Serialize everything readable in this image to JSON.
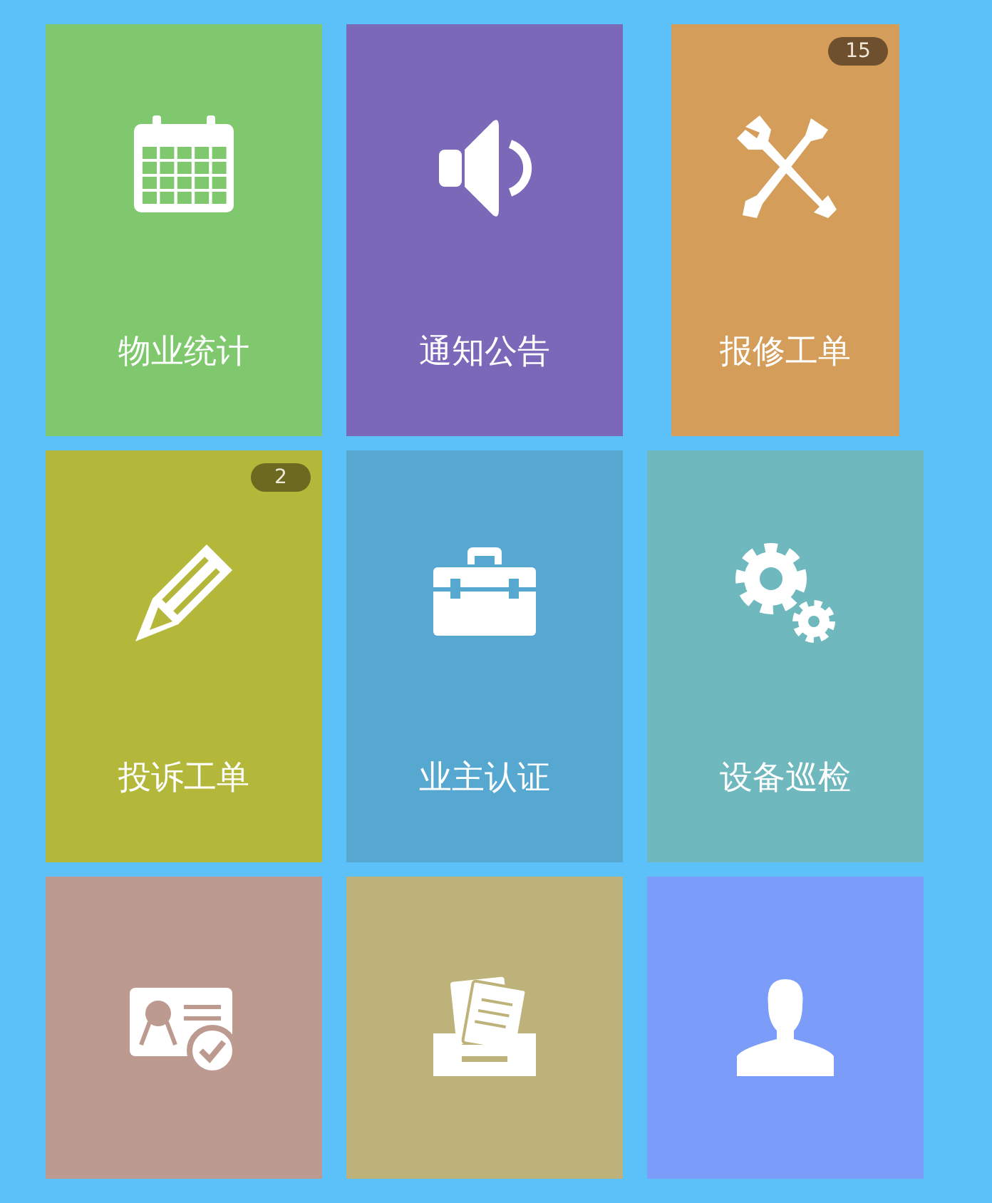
{
  "tiles": [
    {
      "label": "物业统计",
      "color": "#80c86e"
    },
    {
      "label": "通知公告",
      "color": "#7b68b9"
    },
    {
      "label": "报修工单",
      "color": "#d49e5a",
      "badge": "15"
    },
    {
      "label": "投诉工单",
      "color": "#b4b83a",
      "badge": "2"
    },
    {
      "label": "业主认证",
      "color": "#57a8d0"
    },
    {
      "label": "设备巡检",
      "color": "#6fb8bd"
    },
    {
      "color": "#bd9a8f"
    },
    {
      "color": "#bdb27a"
    },
    {
      "color": "#7b9cf8"
    }
  ]
}
